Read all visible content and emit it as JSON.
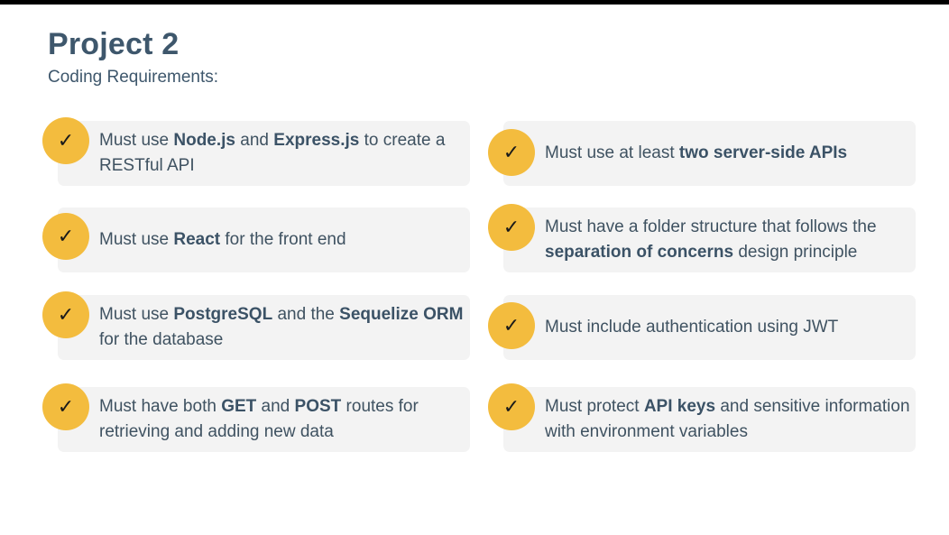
{
  "slide": {
    "title": "Project 2",
    "subtitle": "Coding Requirements:"
  },
  "colors": {
    "title": "#3e576c",
    "card_bg": "#f3f3f3",
    "check_bg": "#f3bc3e",
    "text": "#3f5261"
  },
  "check_icon": {
    "glyph": "✓",
    "icon": "check-icon"
  },
  "requirements": [
    {
      "segments": [
        {
          "t": "Must use "
        },
        {
          "t": "Node.js",
          "b": true
        },
        {
          "t": " and "
        },
        {
          "t": "Express.js",
          "b": true
        },
        {
          "t": " to create a RESTful API"
        }
      ]
    },
    {
      "segments": [
        {
          "t": "Must use at least "
        },
        {
          "t": "two server-side APIs",
          "b": true
        }
      ]
    },
    {
      "segments": [
        {
          "t": "Must use "
        },
        {
          "t": "React",
          "b": true
        },
        {
          "t": " for the front end"
        }
      ]
    },
    {
      "segments": [
        {
          "t": "Must have a folder structure that follows the "
        },
        {
          "t": "separation of concerns",
          "b": true
        },
        {
          "t": " design principle"
        }
      ]
    },
    {
      "segments": [
        {
          "t": "Must use "
        },
        {
          "t": "PostgreSQL",
          "b": true
        },
        {
          "t": " and the "
        },
        {
          "t": "Sequelize ORM",
          "b": true
        },
        {
          "t": " for the database"
        }
      ]
    },
    {
      "segments": [
        {
          "t": "Must include authentication using JWT"
        }
      ]
    },
    {
      "segments": [
        {
          "t": "Must have both "
        },
        {
          "t": "GET",
          "b": true
        },
        {
          "t": " and "
        },
        {
          "t": "POST",
          "b": true
        },
        {
          "t": " routes for retrieving and adding new data"
        }
      ]
    },
    {
      "segments": [
        {
          "t": "Must protect "
        },
        {
          "t": "API keys",
          "b": true
        },
        {
          "t": " and sensitive information with environment variables"
        }
      ]
    }
  ]
}
